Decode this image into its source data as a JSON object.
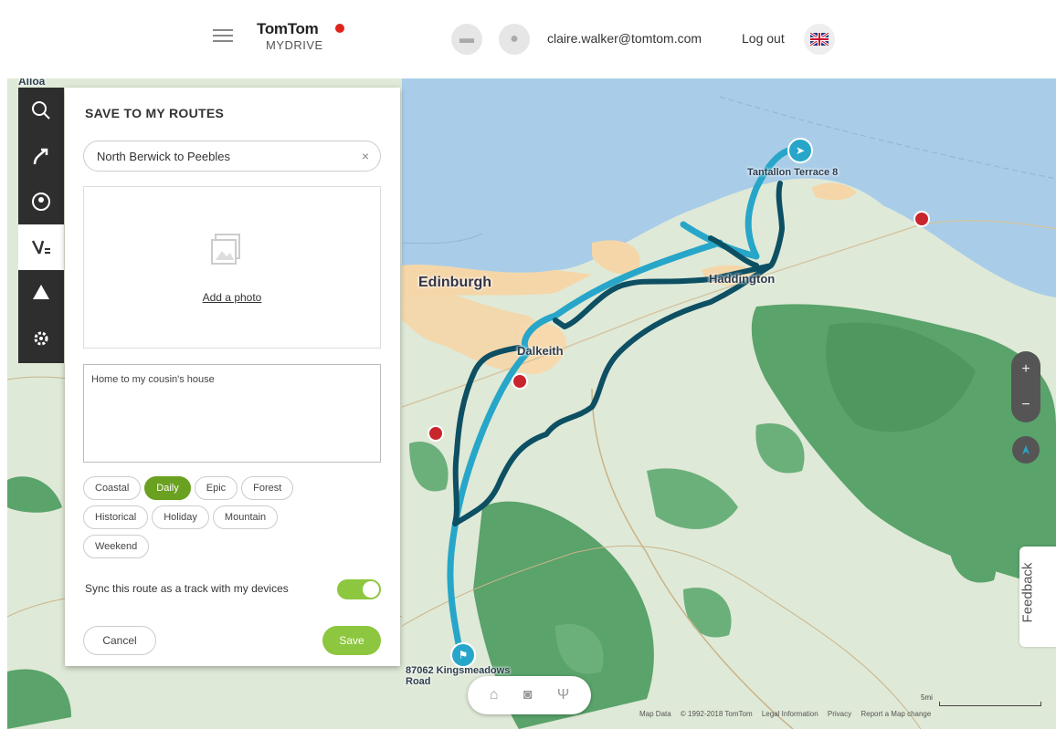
{
  "header": {
    "brand": "TomTom",
    "brand_sub": "MYDRIVE",
    "email": "claire.walker@tomtom.com",
    "logout_label": "Log out"
  },
  "map": {
    "places": {
      "alloa": "Alloa",
      "edinburgh": "Edinburgh",
      "dalkeith": "Dalkeith",
      "haddington": "Haddington",
      "tantallon": "Tantallon Terrace 8",
      "kingsmeadow": "87062 Kingsmeadows Road"
    },
    "feedback_label": "Feedback",
    "scale_label": "5mi",
    "attribution": [
      "Map Data",
      "© 1992-2018 TomTom",
      "Legal Information",
      "Privacy",
      "Report a Map change"
    ]
  },
  "panel": {
    "title": "SAVE TO MY ROUTES",
    "route_name": "North Berwick to Peebles",
    "add_photo_label": "Add a photo",
    "description": "Home to my cousin's house",
    "tags": [
      {
        "label": "Coastal",
        "selected": false
      },
      {
        "label": "Daily",
        "selected": true
      },
      {
        "label": "Epic",
        "selected": false
      },
      {
        "label": "Forest",
        "selected": false
      },
      {
        "label": "Historical",
        "selected": false
      },
      {
        "label": "Holiday",
        "selected": false
      },
      {
        "label": "Mountain",
        "selected": false
      },
      {
        "label": "Weekend",
        "selected": false
      }
    ],
    "sync_label": "Sync this route as a track with my devices",
    "sync_enabled": true,
    "cancel_label": "Cancel",
    "save_label": "Save"
  },
  "colors": {
    "accent_green": "#8dc63f",
    "selected_tag": "#6aa121",
    "route_light": "#27a6c9",
    "route_dark": "#0d4f63",
    "sea": "#a9cde8"
  }
}
